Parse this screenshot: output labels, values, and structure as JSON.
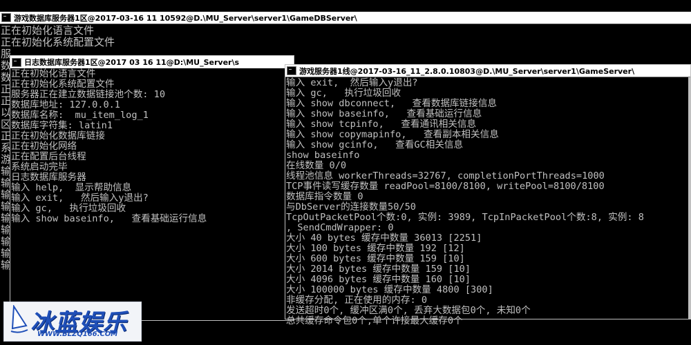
{
  "windows": {
    "db": {
      "title": "游戏数据库服务器1区@2017-03-16 11 10592@D.\\MU_Server\\server1\\GameDBServer\\",
      "lines": [
        "正在初始化语言文件",
        "正在初始化系统配置文件",
        "服",
        "数",
        "数",
        "正",
        "正",
        "以",
        "区",
        "正",
        "系",
        "游",
        "输",
        "输",
        "输",
        "输",
        "输",
        "输",
        "输",
        "输",
        "输"
      ]
    },
    "log": {
      "title": "日志数据库服务器1区@2017 03 16 11@D:\\MU_Server\\s",
      "lines": [
        "正在初始化语言文件",
        "正在初始化系统配置文件",
        "服务器正在建立数据链接池个数: 10",
        "数据库地址: 127.0.0.1",
        "数据库名称:  mu_item_log_1",
        "数据库字符集: latin1",
        "正在初始化数据库链接",
        "正在初始化网络",
        "正在配置后台线程",
        "系统启动完毕",
        "日志数据库服务器",
        "输入 help,  显示帮助信息",
        "输入 exit,   然后输入y退出?",
        "输入 gc,   执行垃圾回收",
        "输入 show baseinfo,   查看基础运行信息"
      ]
    },
    "game": {
      "title": "游戏服务器1线@2017-03-16_11_2.8.0.10803@D.\\MU_Server\\server1\\GameServer\\",
      "lines": [
        "输入 exit,  然后输入y退出?",
        "输入 gc,   执行垃圾回收",
        "输入 show dbconnect,   查看数据库链接信息",
        "输入 show baseinfo,   查看基础运行信息",
        "输入 show tcpinfo,   查看通讯相关信息",
        "输入 show copymapinfo,   查看副本相关信息",
        "输入 show gcinfo,   查看GC相关信息",
        "show baseinfo",
        "在线数量 0/0",
        "线程池信息 workerThreads=32767, completionPortThreads=1000",
        "TCP事件读写缓存数量 readPool=8100/8100, writePool=8100/8100",
        "数据库指令数量 0",
        "与DbServer的连接数量50/50",
        "TcpOutPacketPool个数:0, 实例: 3989, TcpInPacketPool个数:8, 实例: 8",
        ", SendCmdWrapper: 0",
        "大小 40 bytes 缓存中数量 36013 [2251]",
        "大小 100 bytes 缓存中数量 192 [12]",
        "大小 600 bytes 缓存中数量 159 [10]",
        "大小 2014 bytes 缓存中数量 159 [10]",
        "大小 4096 bytes 缓存中数量 160 [10]",
        "大小 100000 bytes 缓存中数量 4800 [300]",
        "非缓存分配, 正在使用的内存: 0",
        "发送超时0个, 缓冲区满0个, 丢弃大数据包0个, 未知0个",
        "总共缓存命令包0个,单个许接最大缓存0个"
      ]
    }
  },
  "watermark": {
    "brand": "冰蓝娱乐",
    "url": "WWW.BLZQ166.COM"
  }
}
